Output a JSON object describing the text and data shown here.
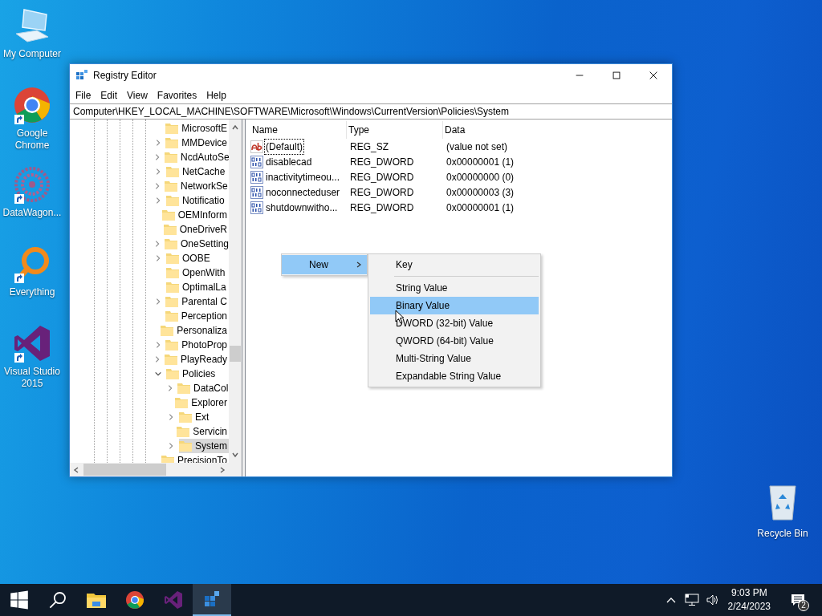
{
  "desktop_icons": [
    {
      "label": "My Computer",
      "kind": "computer",
      "shortcut": false
    },
    {
      "label": "Google Chrome",
      "kind": "chrome",
      "shortcut": true
    },
    {
      "label": "DataWagon...",
      "kind": "datawagon",
      "shortcut": true
    },
    {
      "label": "Everything",
      "kind": "everything",
      "shortcut": true
    },
    {
      "label": "Visual Studio 2015",
      "kind": "vs",
      "shortcut": true
    }
  ],
  "recycle_bin": {
    "label": "Recycle Bin"
  },
  "window": {
    "title": "Registry Editor",
    "menu": [
      "File",
      "Edit",
      "View",
      "Favorites",
      "Help"
    ],
    "address": "Computer\\HKEY_LOCAL_MACHINE\\SOFTWARE\\Microsoft\\Windows\\CurrentVersion\\Policies\\System"
  },
  "tree": {
    "items": [
      {
        "label": "MicrosoftE",
        "expandable": false,
        "selected": false
      },
      {
        "label": "MMDevice",
        "expandable": true,
        "expanded": false,
        "selected": false
      },
      {
        "label": "NcdAutoSe",
        "expandable": true,
        "expanded": false,
        "selected": false
      },
      {
        "label": "NetCache",
        "expandable": true,
        "expanded": false,
        "selected": false
      },
      {
        "label": "NetworkSe",
        "expandable": true,
        "expanded": false,
        "selected": false
      },
      {
        "label": "Notificatio",
        "expandable": true,
        "expanded": false,
        "selected": false
      },
      {
        "label": "OEMInform",
        "expandable": false,
        "selected": false
      },
      {
        "label": "OneDriveR",
        "expandable": false,
        "selected": false
      },
      {
        "label": "OneSetting",
        "expandable": true,
        "expanded": false,
        "selected": false
      },
      {
        "label": "OOBE",
        "expandable": true,
        "expanded": false,
        "selected": false
      },
      {
        "label": "OpenWith",
        "expandable": false,
        "selected": false
      },
      {
        "label": "OptimalLa",
        "expandable": false,
        "selected": false
      },
      {
        "label": "Parental C",
        "expandable": true,
        "expanded": false,
        "selected": false
      },
      {
        "label": "Perception",
        "expandable": false,
        "selected": false
      },
      {
        "label": "Personaliza",
        "expandable": false,
        "selected": false
      },
      {
        "label": "PhotoProp",
        "expandable": true,
        "expanded": false,
        "selected": false
      },
      {
        "label": "PlayReady",
        "expandable": true,
        "expanded": false,
        "selected": false
      },
      {
        "label": "Policies",
        "expandable": true,
        "expanded": true,
        "selected": false,
        "children": [
          {
            "label": "DataCol",
            "expandable": true,
            "expanded": false,
            "selected": false
          },
          {
            "label": "Explorer",
            "expandable": false,
            "selected": false
          },
          {
            "label": "Ext",
            "expandable": true,
            "expanded": false,
            "selected": false
          },
          {
            "label": "Servicin",
            "expandable": false,
            "selected": false
          },
          {
            "label": "System",
            "expandable": true,
            "expanded": false,
            "selected": true
          }
        ]
      },
      {
        "label": "PrecisionTo",
        "expandable": false,
        "selected": false
      }
    ]
  },
  "values": {
    "columns": [
      "Name",
      "Type",
      "Data"
    ],
    "rows": [
      {
        "name": "(Default)",
        "type": "REG_SZ",
        "data": "(value not set)",
        "kind": "string",
        "focused": true
      },
      {
        "name": "disablecad",
        "type": "REG_DWORD",
        "data": "0x00000001 (1)",
        "kind": "binary",
        "focused": false
      },
      {
        "name": "inactivitytimeou...",
        "type": "REG_DWORD",
        "data": "0x00000000 (0)",
        "kind": "binary",
        "focused": false
      },
      {
        "name": "noconnecteduser",
        "type": "REG_DWORD",
        "data": "0x00000003 (3)",
        "kind": "binary",
        "focused": false
      },
      {
        "name": "shutdownwitho...",
        "type": "REG_DWORD",
        "data": "0x00000001 (1)",
        "kind": "binary",
        "focused": false
      }
    ]
  },
  "context_menu": {
    "items": [
      {
        "label": "New",
        "selected": true,
        "submenu": true
      }
    ]
  },
  "submenu": {
    "items": [
      {
        "kind": "item",
        "label": "Key",
        "selected": false
      },
      {
        "kind": "separator"
      },
      {
        "kind": "item",
        "label": "String Value",
        "selected": false
      },
      {
        "kind": "item",
        "label": "Binary Value",
        "selected": true
      },
      {
        "kind": "item",
        "label": "DWORD (32-bit) Value",
        "selected": false
      },
      {
        "kind": "item",
        "label": "QWORD (64-bit) Value",
        "selected": false
      },
      {
        "kind": "item",
        "label": "Multi-String Value",
        "selected": false
      },
      {
        "kind": "item",
        "label": "Expandable String Value",
        "selected": false
      }
    ]
  },
  "taskbar": {
    "apps": [
      {
        "kind": "start",
        "active": false
      },
      {
        "kind": "search",
        "active": false
      },
      {
        "kind": "explorer",
        "active": false
      },
      {
        "kind": "chrome",
        "active": false
      },
      {
        "kind": "vs",
        "active": false
      },
      {
        "kind": "regedit",
        "active": true
      }
    ],
    "time": "9:03 PM",
    "date": "2/24/2023",
    "notification_count": "2"
  }
}
